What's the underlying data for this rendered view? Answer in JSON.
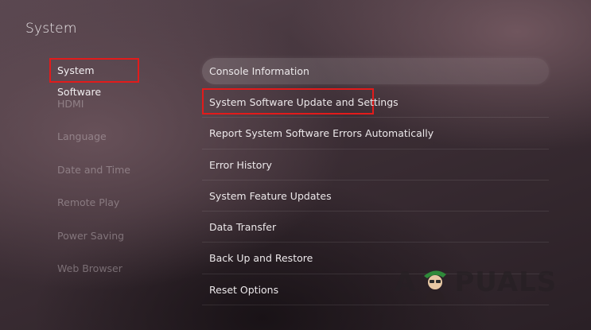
{
  "page": {
    "title": "System"
  },
  "sidebar": {
    "items": [
      {
        "label": "System Software",
        "active": true
      },
      {
        "label": "HDMI"
      },
      {
        "label": "Language"
      },
      {
        "label": "Date and Time"
      },
      {
        "label": "Remote Play"
      },
      {
        "label": "Power Saving"
      },
      {
        "label": "Web Browser"
      }
    ]
  },
  "menu": {
    "items": [
      {
        "label": "Console Information",
        "focused": true
      },
      {
        "label": "System Software Update and Settings",
        "highlighted": true
      },
      {
        "label": "Report System Software Errors Automatically"
      },
      {
        "label": "Error History"
      },
      {
        "label": "System Feature Updates"
      },
      {
        "label": "Data Transfer"
      },
      {
        "label": "Back Up and Restore"
      },
      {
        "label": "Reset Options"
      }
    ]
  },
  "watermark": {
    "text_left": "A",
    "text_right": "PUALS",
    "icon": "mascot-logo"
  },
  "colors": {
    "highlight_box": "#e21b1b",
    "background": "#3c2e35",
    "text": "#ece8ea"
  }
}
